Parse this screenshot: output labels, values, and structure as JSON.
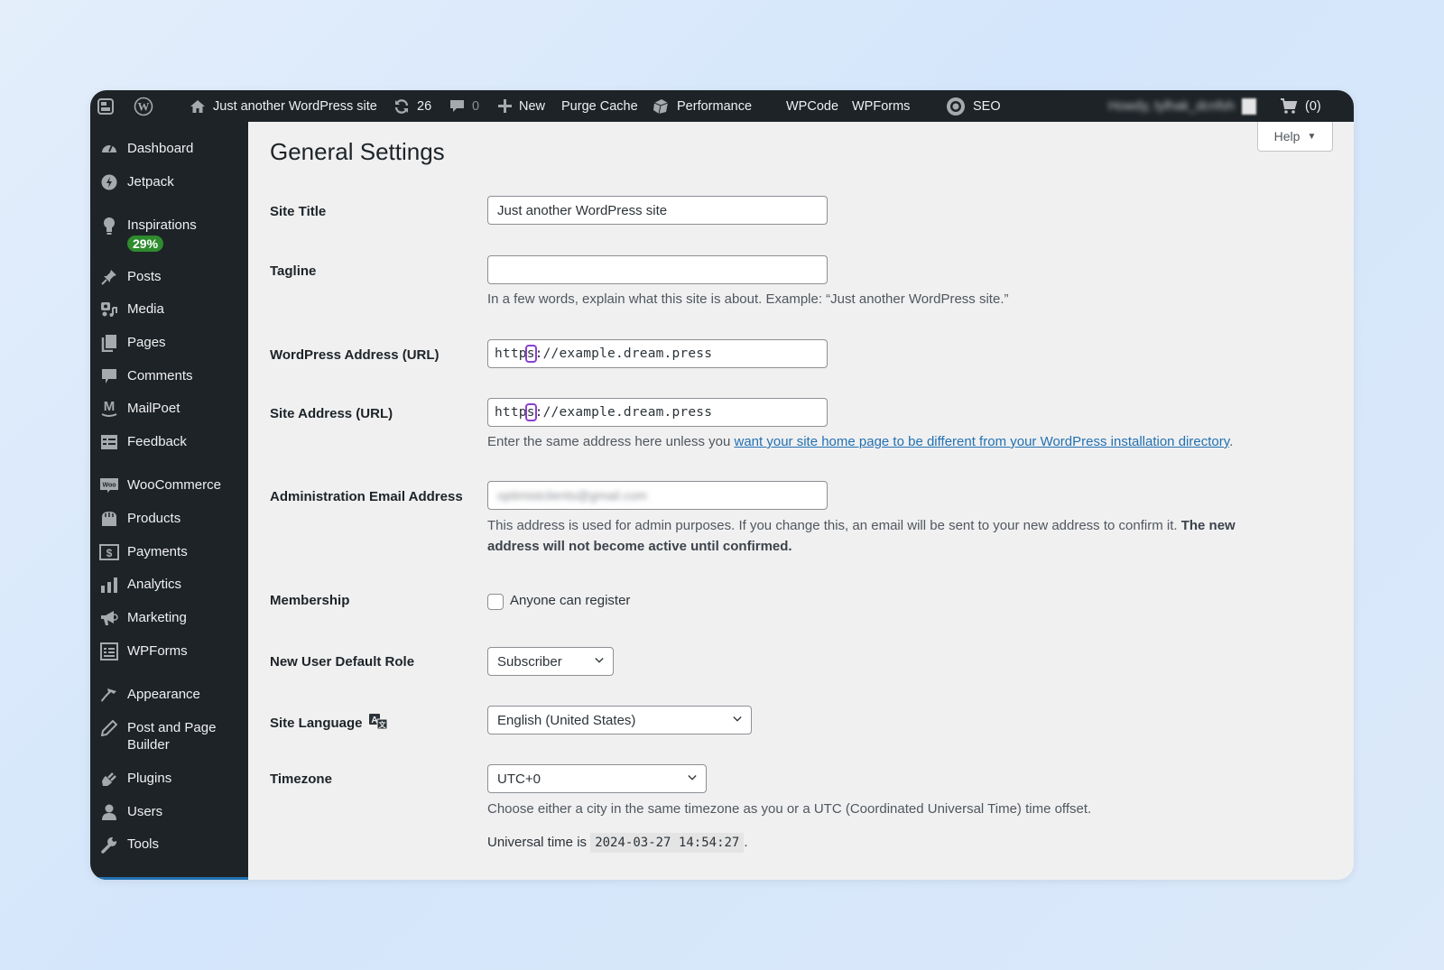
{
  "adminbar": {
    "site_name": "Just another WordPress site",
    "updates_count": "26",
    "comments_count": "0",
    "new_label": "New",
    "purge_cache_label": "Purge Cache",
    "performance_label": "Performance",
    "wpcode_label": "WPCode",
    "wpforms_label": "WPForms",
    "seo_label": "SEO",
    "howdy_label": "Howdy, tylhak_dcnfsh",
    "cart_label": "(0)"
  },
  "sidebar": {
    "items": [
      {
        "label": "Dashboard",
        "icon": "dashboard-icon"
      },
      {
        "label": "Jetpack",
        "icon": "jetpack-icon"
      },
      {
        "label": "Inspirations",
        "icon": "lightbulb-icon",
        "badge": "29%"
      },
      {
        "label": "Posts",
        "icon": "pin-icon"
      },
      {
        "label": "Media",
        "icon": "media-icon"
      },
      {
        "label": "Pages",
        "icon": "pages-icon"
      },
      {
        "label": "Comments",
        "icon": "comment-icon"
      },
      {
        "label": "MailPoet",
        "icon": "mailpoet-icon"
      },
      {
        "label": "Feedback",
        "icon": "feedback-icon"
      },
      {
        "label": "WooCommerce",
        "icon": "woo-icon"
      },
      {
        "label": "Products",
        "icon": "products-icon"
      },
      {
        "label": "Payments",
        "icon": "dollar-icon"
      },
      {
        "label": "Analytics",
        "icon": "bar-chart-icon"
      },
      {
        "label": "Marketing",
        "icon": "megaphone-icon"
      },
      {
        "label": "WPForms",
        "icon": "forms-icon"
      },
      {
        "label": "Appearance",
        "icon": "brush-icon"
      },
      {
        "label": "Post and Page Builder",
        "line1": "Post and Page",
        "line2": "Builder",
        "icon": "pencil-icon"
      },
      {
        "label": "Plugins",
        "icon": "plug-icon"
      },
      {
        "label": "Users",
        "icon": "user-icon"
      },
      {
        "label": "Tools",
        "icon": "wrench-icon"
      }
    ]
  },
  "main": {
    "help_label": "Help",
    "title": "General Settings",
    "site_title": {
      "label": "Site Title",
      "value": "Just another WordPress site"
    },
    "tagline": {
      "label": "Tagline",
      "value": "",
      "description": "In a few words, explain what this site is about. Example: “Just another WordPress site.”"
    },
    "wp_address": {
      "label": "WordPress Address (URL)",
      "value_pre": "http",
      "value_hl": "s",
      "value_post": "://example.dream.press"
    },
    "site_address": {
      "label": "Site Address (URL)",
      "value_pre": "http",
      "value_hl": "s",
      "value_post": "://example.dream.press",
      "description_pre": "Enter the same address here unless you ",
      "description_link": "want your site home page to be different from your WordPress installation directory",
      "description_post": "."
    },
    "admin_email": {
      "label": "Administration Email Address",
      "value": "optimistclients@gmail.com",
      "description_pre": "This address is used for admin purposes. If you change this, an email will be sent to your new address to confirm it. ",
      "description_bold": "The new address will not become active until confirmed."
    },
    "membership": {
      "label": "Membership",
      "checkbox_label": "Anyone can register",
      "checked": false
    },
    "default_role": {
      "label": "New User Default Role",
      "value": "Subscriber"
    },
    "site_language": {
      "label": "Site Language",
      "value": "English (United States)"
    },
    "timezone": {
      "label": "Timezone",
      "value": "UTC+0",
      "description": "Choose either a city in the same timezone as you or a UTC (Coordinated Universal Time) time offset.",
      "universal_prefix": "Universal time is",
      "universal_time": "2024-03-27 14:54:27",
      "universal_suffix": "."
    }
  }
}
